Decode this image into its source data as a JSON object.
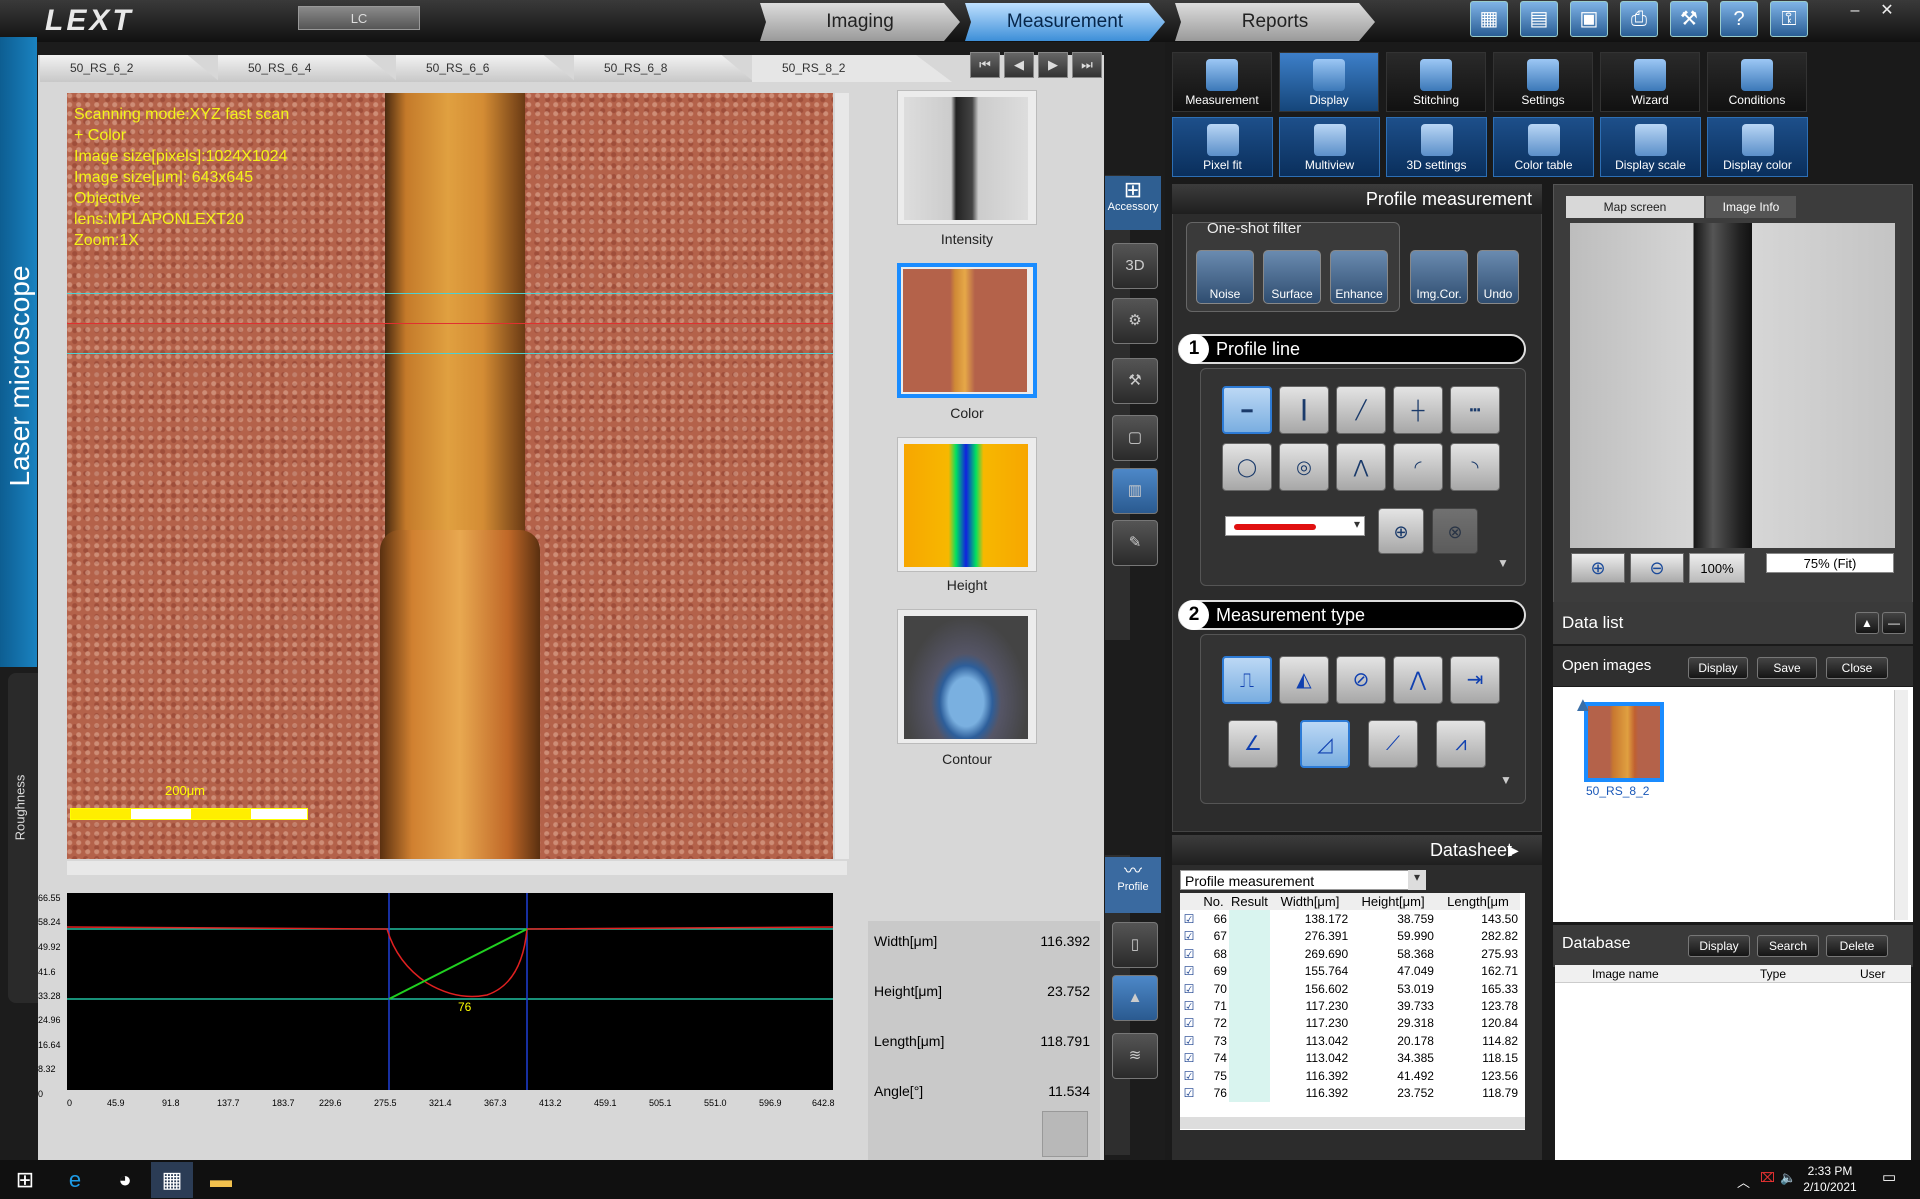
{
  "app": {
    "logo": "LEXT",
    "lc": "LC",
    "side_label": "Laser microscope",
    "rough_label": "Roughness"
  },
  "nav": {
    "imaging": "Imaging",
    "measurement": "Measurement",
    "reports": "Reports"
  },
  "tabs": [
    "50_RS_6_2",
    "50_RS_6_4",
    "50_RS_6_6",
    "50_RS_6_8",
    "50_RS_8_2"
  ],
  "overlay": {
    "text": "Scanning mode:XYZ fast scan\n+ Color\nImage size[pixels]:1024X1024\nImage size[μm]: 643x645\nObjective\nlens:MPLAPONLEXT20\nZoom:1X",
    "scale": "200μm"
  },
  "thumbs": [
    "Intensity",
    "Color",
    "Height",
    "Contour"
  ],
  "graph": {
    "yticks": [
      "66.55",
      "58.24",
      "49.92",
      "41.6",
      "33.28",
      "24.96",
      "16.64",
      "8.32",
      "0"
    ],
    "xticks": [
      "0",
      "45.9",
      "91.8",
      "137.7",
      "183.7",
      "229.6",
      "275.5",
      "321.4",
      "367.3",
      "413.2",
      "459.1",
      "505.1",
      "551.0",
      "596.9",
      "642.8"
    ],
    "marker": "76"
  },
  "results": [
    {
      "label": "Width[μm]",
      "value": "116.392"
    },
    {
      "label": "Height[μm]",
      "value": "23.752"
    },
    {
      "label": "Length[μm]",
      "value": "118.791"
    },
    {
      "label": "Angle[°]",
      "value": "11.534"
    }
  ],
  "side": {
    "accessory": "Accessory",
    "profile": "Profile"
  },
  "ribbon1": [
    "Measurement",
    "Display",
    "Stitching",
    "Settings",
    "Wizard",
    "Conditions"
  ],
  "ribbon2": [
    "Pixel fit",
    "Multiview",
    "3D settings",
    "Color table",
    "Display scale",
    "Display color"
  ],
  "pm": {
    "title": "Profile measurement",
    "oneshot": "One-shot filter",
    "filters": [
      "Noise",
      "Surface",
      "Enhance",
      "Img.Cor.",
      "Undo"
    ],
    "sec1": "Profile line",
    "sec2": "Measurement type"
  },
  "datasheet": {
    "title": "Datasheet",
    "select": "Profile measurement",
    "headers": [
      "No.",
      "Result",
      "Width[μm]",
      "Height[μm]",
      "Length[μm"
    ],
    "rows": [
      [
        "66",
        "",
        "138.172",
        "38.759",
        "143.50"
      ],
      [
        "67",
        "",
        "276.391",
        "59.990",
        "282.82"
      ],
      [
        "68",
        "",
        "269.690",
        "58.368",
        "275.93"
      ],
      [
        "69",
        "",
        "155.764",
        "47.049",
        "162.71"
      ],
      [
        "70",
        "",
        "156.602",
        "53.019",
        "165.33"
      ],
      [
        "71",
        "",
        "117.230",
        "39.733",
        "123.78"
      ],
      [
        "72",
        "",
        "117.230",
        "29.318",
        "120.84"
      ],
      [
        "73",
        "",
        "113.042",
        "20.178",
        "114.82"
      ],
      [
        "74",
        "",
        "113.042",
        "34.385",
        "118.15"
      ],
      [
        "75",
        "",
        "116.392",
        "41.492",
        "123.56"
      ],
      [
        "76",
        "",
        "116.392",
        "23.752",
        "118.79"
      ]
    ]
  },
  "map": {
    "tab1": "Map screen",
    "tab2": "Image Info",
    "zoom": "100%",
    "fit": "75% (Fit)"
  },
  "datalist": {
    "title": "Data list",
    "open": "Open images",
    "display": "Display",
    "save": "Save",
    "close": "Close",
    "thumb": "50_RS_8_2"
  },
  "database": {
    "title": "Database",
    "display": "Display",
    "search": "Search",
    "delete": "Delete",
    "cols": [
      "Image name",
      "Type",
      "User"
    ]
  },
  "clock": {
    "time": "2:33 PM",
    "date": "2/10/2021"
  }
}
